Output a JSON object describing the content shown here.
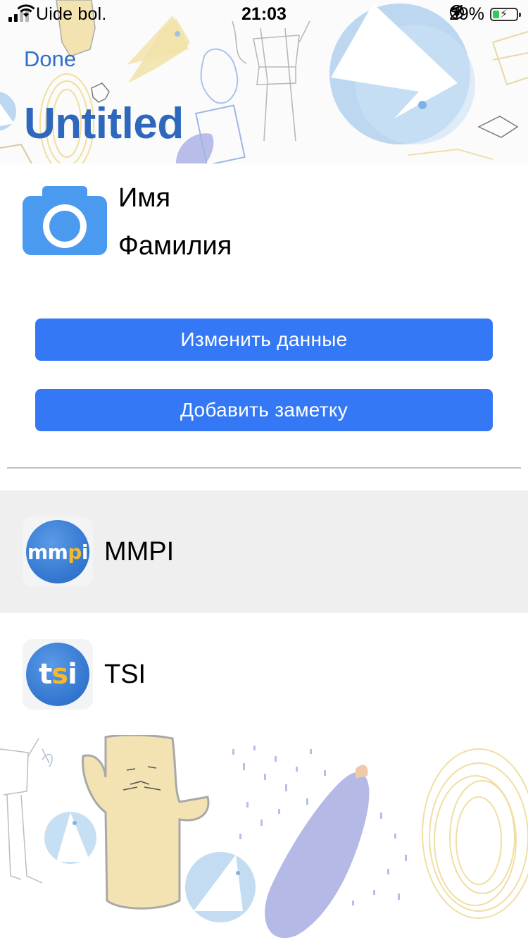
{
  "status_bar": {
    "carrier": "Uide bol.",
    "time": "21:03",
    "battery_percent": "29%",
    "signal_bars_active": 2,
    "signal_bars_total": 4,
    "battery_level": 0.29,
    "icons": [
      "signal-icon",
      "wifi-icon",
      "orientation-lock-icon",
      "location-icon",
      "battery-icon"
    ]
  },
  "nav": {
    "done_label": "Done",
    "title": "Untitled"
  },
  "profile": {
    "first_name": "Имя",
    "last_name": "Фамилия",
    "photo_icon": "camera-icon"
  },
  "actions": {
    "edit_label": "Изменить данные",
    "note_label": "Добавить заметку"
  },
  "tests": [
    {
      "name": "MMPI",
      "icon_text_main": "mm",
      "icon_text_accent": "p",
      "icon_text_end": "i",
      "selected": true
    },
    {
      "name": "TSI",
      "icon_text_main": "t",
      "icon_text_accent": "s",
      "icon_text_end": "i",
      "selected": false
    }
  ],
  "colors": {
    "accent": "#3478f6",
    "title": "#2e68bd",
    "selected_row": "#efefef",
    "icon_yellow": "#f4b92c"
  }
}
